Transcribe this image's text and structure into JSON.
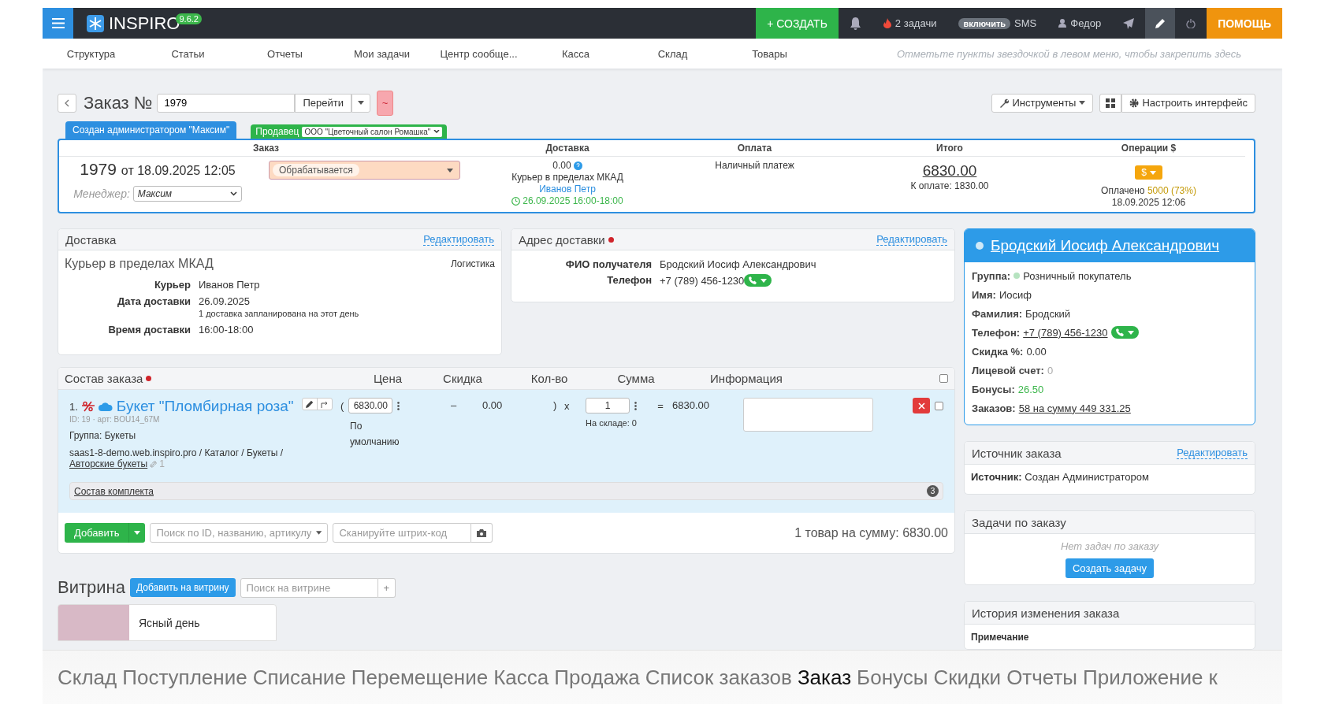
{
  "topbar": {
    "app_name": "INSPIRO",
    "version": "9.6.2",
    "create_button": "+ СОЗДАТЬ",
    "tasks": "2 задачи",
    "sms_toggle": "включить",
    "sms": "SMS",
    "user": "Федор",
    "help": "ПОМОЩЬ"
  },
  "nav": {
    "items": [
      "Структура",
      "Статьи",
      "Отчеты",
      "Мои задачи",
      "Центр сообще...",
      "Касса",
      "Склад",
      "Товары"
    ],
    "hint": "Отметьте пункты звездочкой в левом меню, чтобы закрепить здесь"
  },
  "order_header": {
    "title": "Заказ №",
    "number": "1979",
    "go_button": "Перейти",
    "tilde_button": "~",
    "tools_button": "Инструменты",
    "configure_button": "Настроить интерфейс"
  },
  "tags": {
    "creator": "Создан администратором \"Максим\"",
    "seller_label": "Продавец",
    "seller_value": "ООО \"Цветочный салон Ромашка\""
  },
  "summary": {
    "columns": [
      "Заказ",
      "Доставка",
      "Оплата",
      "Итого",
      "Операции $"
    ],
    "number": "1979",
    "date": "от 18.09.2025 12:05",
    "manager_label": "Менеджер:",
    "manager_value": "Максим",
    "status": "Обрабатывается",
    "delivery_cost": "0.00",
    "delivery_method": "Курьер в пределах МКАД",
    "courier": "Иванов Петр",
    "delivery_time": "26.09.2025 16:00-18:00",
    "payment": "Наличный платеж",
    "total": "6830.00",
    "to_pay": "К оплате: 1830.00",
    "operations_button": "$",
    "paid_label": "Оплачено",
    "paid_value": "5000 (73%)",
    "paid_date": "18.09.2025 12:06"
  },
  "delivery": {
    "title": "Доставка",
    "edit": "Редактировать",
    "method": "Курьер в пределах МКАД",
    "logistics": "Логистика",
    "rows": [
      {
        "label": "Курьер",
        "value": "Иванов Петр"
      },
      {
        "label": "Дата доставки",
        "value": "26.09.2025",
        "note": "1 доставка запланирована на этот день"
      },
      {
        "label": "Время доставки",
        "value": "16:00-18:00"
      }
    ]
  },
  "address": {
    "title": "Адрес доставки",
    "edit": "Редактировать",
    "rows": [
      {
        "kind": "text",
        "label": "ФИО получателя",
        "value": "Бродский Иосиф Александрович"
      },
      {
        "kind": "phone",
        "label": "Телефон",
        "value": "+7 (789) 456-1230"
      }
    ]
  },
  "items": {
    "title": "Состав заказа",
    "columns": [
      "Цена",
      "Скидка",
      "Кол-во",
      "Сумма",
      "Информация"
    ],
    "select_all": false,
    "rows": [
      {
        "index": "1.",
        "name": "Букет \"Пломбирная роза\"",
        "id_line": "ID: 19 · арт: BOU14_67M",
        "group": "Группа: Букеты",
        "path": "saas1-8-demo.web.inspiro.pro / Каталог / Букеты /",
        "category": "Авторские букеты",
        "link_count": "1",
        "open": "(",
        "price": "6830.00",
        "price_note": "По умолчанию",
        "dash": "–",
        "discount": "0.00",
        "close": ")",
        "times": "x",
        "qty": "1",
        "stock": "На складе: 0",
        "equals": "=",
        "sum": "6830.00",
        "checked": false
      }
    ],
    "kit_label": "Состав комплекта",
    "kit_count": "3",
    "add_button": "Добавить",
    "search_placeholder": "Поиск по ID, названию, артикулу",
    "barcode_placeholder": "Сканируйте штрих-код",
    "total": "1 товар на сумму: 6830.00"
  },
  "showcase": {
    "title": "Витрина",
    "add_button": "Добавить на витрину",
    "search_placeholder": "Поиск на витрине",
    "plus": "+",
    "products": [
      {
        "name": "Ясный день"
      }
    ]
  },
  "customer": {
    "name": "Бродский Иосиф Александрович",
    "fields": [
      {
        "kind": "group",
        "label": "Группа:",
        "value": "Розничный покупатель",
        "color": "#b6e3c0"
      },
      {
        "kind": "text",
        "label": "Имя:",
        "value": "Иосиф"
      },
      {
        "kind": "text",
        "label": "Фамилия:",
        "value": "Бродский"
      },
      {
        "kind": "phone",
        "label": "Телефон:",
        "value": "+7 (789) 456-1230"
      },
      {
        "kind": "text",
        "label": "Скидка %:",
        "value": "0.00"
      },
      {
        "kind": "muted",
        "label": "Лицевой счет:",
        "value": "0"
      },
      {
        "kind": "green",
        "label": "Бонусы:",
        "value": "26.50"
      },
      {
        "kind": "link",
        "label": "Заказов:",
        "value": "58 на сумму 449 331.25"
      }
    ]
  },
  "source": {
    "title": "Источник заказа",
    "edit": "Редактировать",
    "label": "Источник:",
    "value": "Создан Администратором"
  },
  "tasks": {
    "title": "Задачи по заказу",
    "empty": "Нет задач по заказу",
    "create_button": "Создать задачу"
  },
  "history": {
    "title": "История изменения заказа",
    "note_label": "Примечание"
  },
  "chapters": [
    {
      "label": "Склад",
      "selected": false
    },
    {
      "label": "Поступление",
      "selected": false
    },
    {
      "label": "Списание",
      "selected": false
    },
    {
      "label": "Перемещение",
      "selected": false
    },
    {
      "label": "Касса",
      "selected": false
    },
    {
      "label": "Продажа",
      "selected": false
    },
    {
      "label": "Список заказов",
      "selected": false
    },
    {
      "label": "Заказ",
      "selected": true
    },
    {
      "label": "Бонусы",
      "selected": false
    },
    {
      "label": "Скидки",
      "selected": false
    },
    {
      "label": "Отчеты",
      "selected": false
    },
    {
      "label": "Приложение",
      "selected": false
    },
    {
      "label": "к",
      "selected": false
    }
  ]
}
